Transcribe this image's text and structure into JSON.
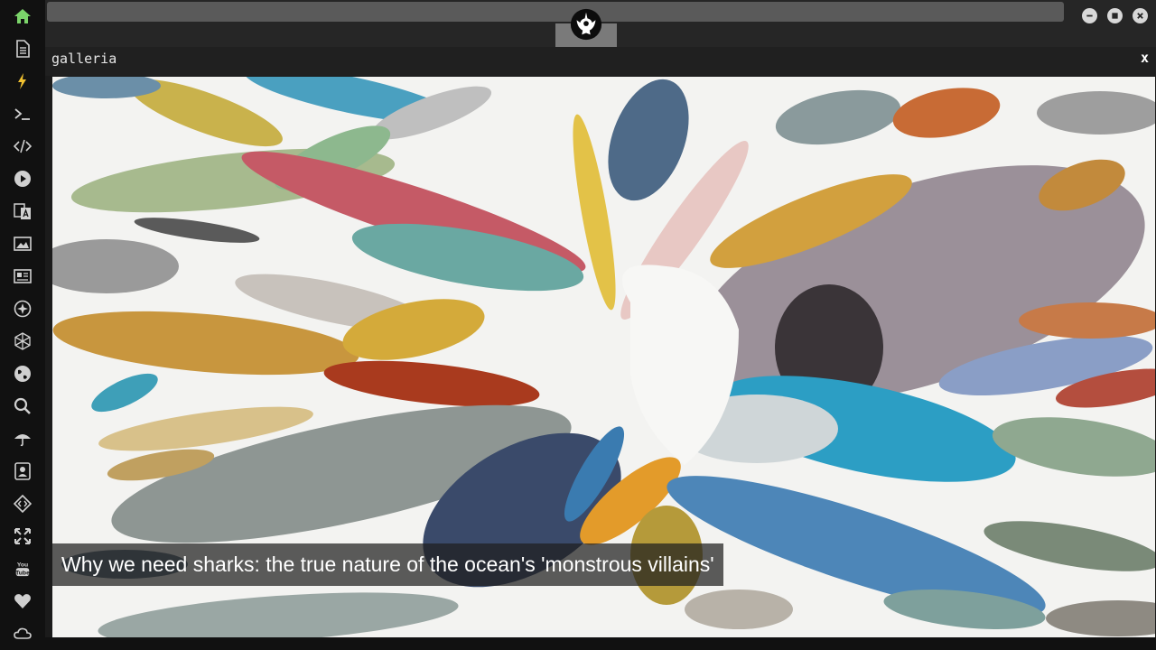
{
  "window": {
    "panel_title": "galleria",
    "close_label": "x"
  },
  "gallery": {
    "caption": "Why we need sharks: the true nature of the ocean's 'monstrous villains'"
  },
  "sidebar": {
    "icons": [
      {
        "name": "home-icon",
        "color": "#7bd46a"
      },
      {
        "name": "document-icon",
        "color": "#d0d0d0"
      },
      {
        "name": "lightning-icon",
        "color": "#f2c230"
      },
      {
        "name": "terminal-icon",
        "color": "#d0d0d0"
      },
      {
        "name": "code-icon",
        "color": "#d0d0d0"
      },
      {
        "name": "play-icon",
        "color": "#d0d0d0"
      },
      {
        "name": "translate-icon",
        "color": "#d0d0d0"
      },
      {
        "name": "image-icon",
        "color": "#d0d0d0"
      },
      {
        "name": "news-icon",
        "color": "#d0d0d0"
      },
      {
        "name": "atom-icon",
        "color": "#d0d0d0"
      },
      {
        "name": "hexagon-icon",
        "color": "#d0d0d0"
      },
      {
        "name": "globe-icon",
        "color": "#d0d0d0"
      },
      {
        "name": "search-icon",
        "color": "#d0d0d0"
      },
      {
        "name": "umbrella-icon",
        "color": "#d0d0d0"
      },
      {
        "name": "contact-icon",
        "color": "#d0d0d0"
      },
      {
        "name": "diamond-code-icon",
        "color": "#d0d0d0"
      },
      {
        "name": "expand-icon",
        "color": "#d0d0d0"
      },
      {
        "name": "youtube-icon",
        "color": "#d0d0d0"
      },
      {
        "name": "heart-icon",
        "color": "#d0d0d0"
      },
      {
        "name": "cloud-icon",
        "color": "#d0d0d0"
      }
    ]
  },
  "colors": {
    "sidebar_bg": "#111111",
    "topbar_bg": "#262626",
    "accent_green": "#7bd46a",
    "accent_yellow": "#f2c230"
  }
}
